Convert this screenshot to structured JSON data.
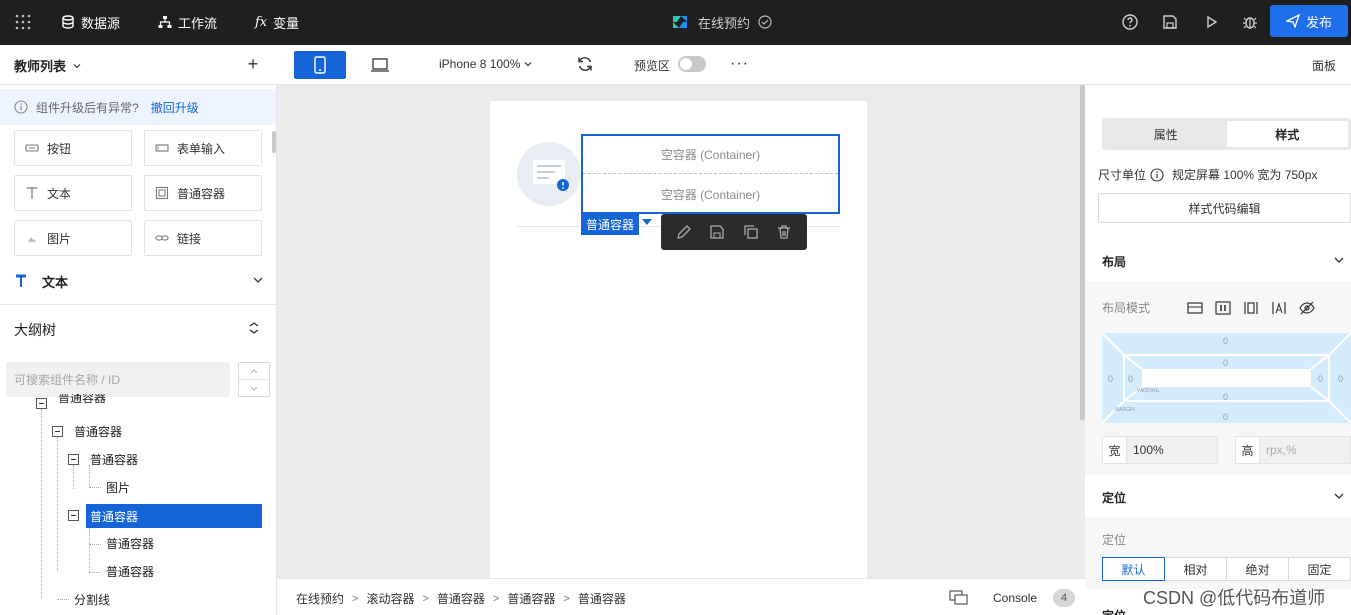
{
  "topbar": {
    "nav": [
      "数据源",
      "工作流",
      "变量"
    ],
    "app_title": "在线预约",
    "publish_label": "发布"
  },
  "toolbar2": {
    "panel_title": "教师列表",
    "plus": "+",
    "device": "iPhone 8 100%",
    "preview_label": "预览区",
    "more": "···",
    "panel_button": "面板"
  },
  "left_panel": {
    "notice_text": "组件升级后有异常?",
    "notice_link": "撤回升级",
    "components": [
      "按钮",
      "表单输入",
      "文本",
      "普通容器",
      "图片",
      "链接"
    ],
    "section_text": "文本",
    "outline_title": "大纲树",
    "search_placeholder": "可搜索组件名称 / ID",
    "tree": [
      "普通容器",
      "普通容器",
      "普通容器",
      "图片",
      "普通容器",
      "普通容器",
      "普通容器",
      "分割线"
    ]
  },
  "canvas": {
    "container_1": "空容器 (Container)",
    "container_2": "空容器 (Container)",
    "selected_tag": "普通容器"
  },
  "bottom_bar": {
    "breadcrumb": [
      "在线预约",
      "滚动容器",
      "普通容器",
      "普通容器",
      "普通容器"
    ],
    "console_label": "Console",
    "console_count": "4"
  },
  "right_panel": {
    "tabs": [
      "属性",
      "样式"
    ],
    "size_unit_label": "尺寸单位",
    "size_unit_value": "规定屏幕 100% 宽为 750px",
    "style_code_button": "样式代码编辑",
    "layout_section": "布局",
    "layout_mode_label": "布局模式",
    "box_values": [
      "0",
      "0",
      "0",
      "0",
      "0",
      "0",
      "0",
      "0"
    ],
    "padding_label": "PADDING",
    "margin_label": "MARGIN",
    "width_label": "宽",
    "width_value": "100%",
    "height_label": "高",
    "height_placeholder": "rpx,%",
    "position_section": "定位",
    "position_label": "定位",
    "position_options": [
      "默认",
      "相对",
      "绝对",
      "固定"
    ],
    "next_section": "定位"
  },
  "watermark": "CSDN @低代码布道师",
  "colors": {
    "topbar_bg": "#1f1f1f",
    "accent": "#1565d8",
    "publish_bg": "#1f6feb",
    "canvas_bg": "#ebebeb"
  }
}
